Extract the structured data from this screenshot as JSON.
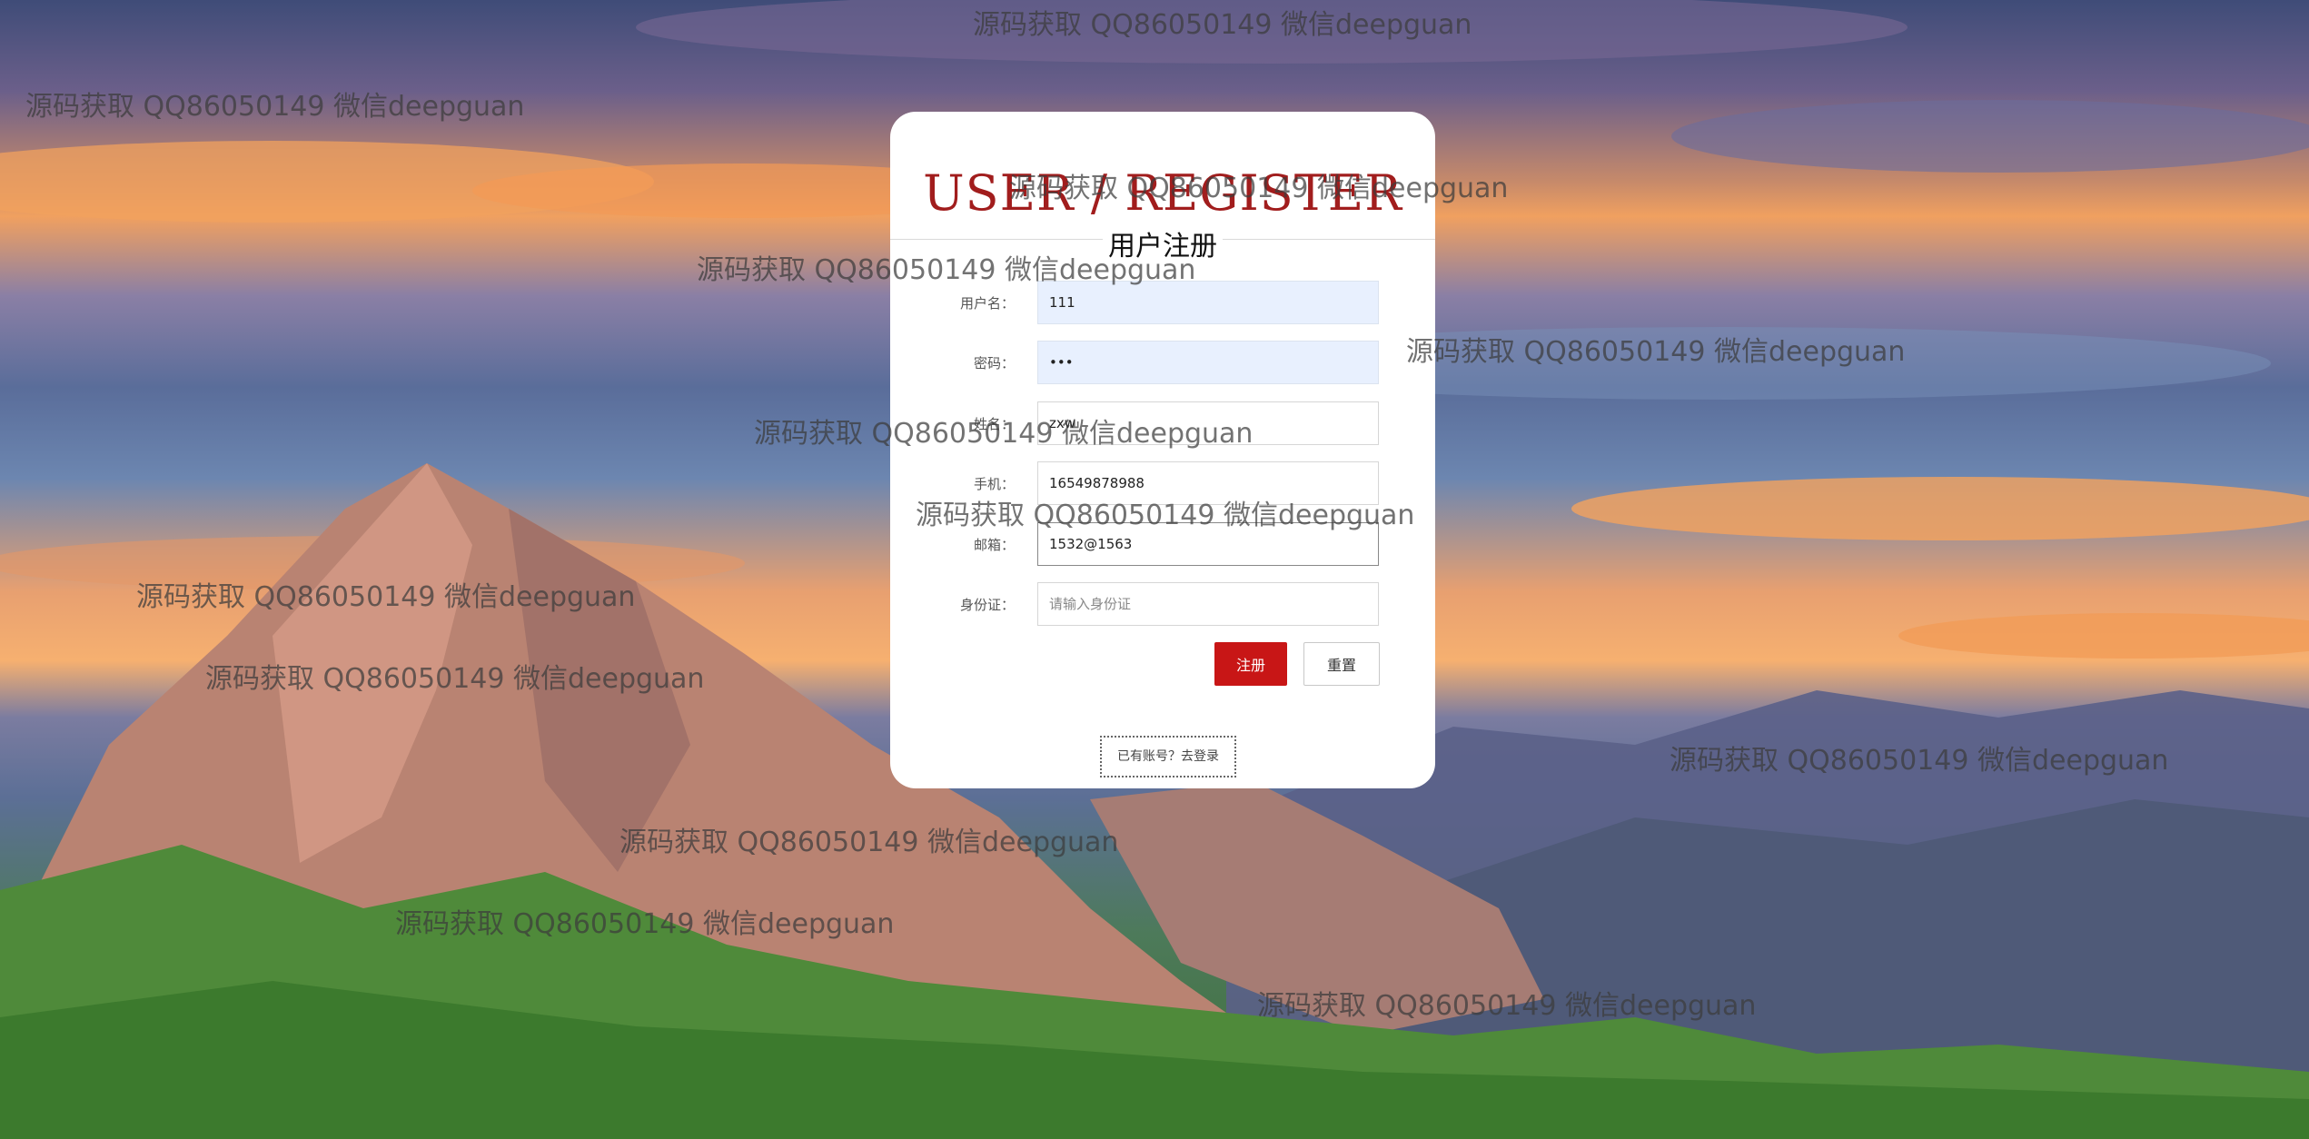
{
  "card": {
    "title_en": "USER / REGISTER",
    "title_cn": "用户注册"
  },
  "form": {
    "fields": [
      {
        "label": "用户名：",
        "value": "111",
        "placeholder": "",
        "type": "text"
      },
      {
        "label": "密码：",
        "value": "•••",
        "placeholder": "",
        "type": "text"
      },
      {
        "label": "姓名：",
        "value": "zxw",
        "placeholder": "",
        "type": "text"
      },
      {
        "label": "手机：",
        "value": "16549878988",
        "placeholder": "",
        "type": "text"
      },
      {
        "label": "邮箱：",
        "value": "1532@1563",
        "placeholder": "",
        "type": "text"
      },
      {
        "label": "身份证：",
        "value": "",
        "placeholder": "请输入身份证",
        "type": "text"
      }
    ],
    "register_label": "注册",
    "reset_label": "重置",
    "login_link": "已有账号？去登录"
  },
  "watermark_text": "源码获取 QQ86050149 微信deepguan",
  "colors": {
    "accent": "#c81616",
    "title_red": "#a11d1d",
    "autofill_bg": "#e8f0fe"
  }
}
